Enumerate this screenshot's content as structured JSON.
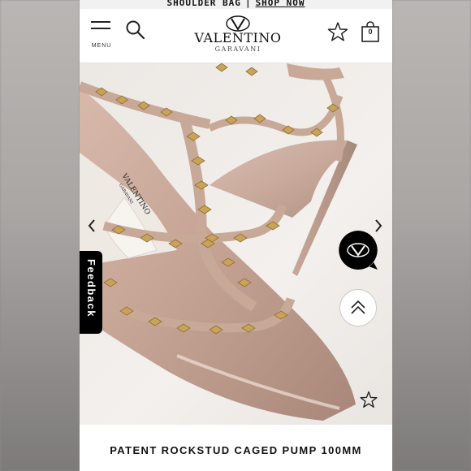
{
  "promo": {
    "text": "SHOULDER BAG",
    "divider": "|",
    "link": "SHOP NOW"
  },
  "header": {
    "menu_label": "MENU",
    "brand": "VALENTINO",
    "brand_sub": "GARAVANI",
    "bag_count": "0",
    "icons": [
      "menu-icon",
      "search-icon",
      "valentino-v-logo",
      "star-icon",
      "shopping-bag-icon"
    ]
  },
  "product": {
    "insole_brand": "VALENTINO",
    "insole_sub": "GARAVANI",
    "title": "PATENT ROCKSTUD CAGED PUMP 100MM"
  },
  "overlay": {
    "feedback_label": "Feedback",
    "icons": [
      "chevron-left-icon",
      "chevron-right-icon",
      "chat-icon",
      "scroll-top-icon",
      "wishlist-star-icon"
    ]
  },
  "colors": {
    "accent": "#000000",
    "shoe_nude": "#c9a898",
    "stud_gold": "#c9a35a",
    "background": "#ffffff"
  }
}
